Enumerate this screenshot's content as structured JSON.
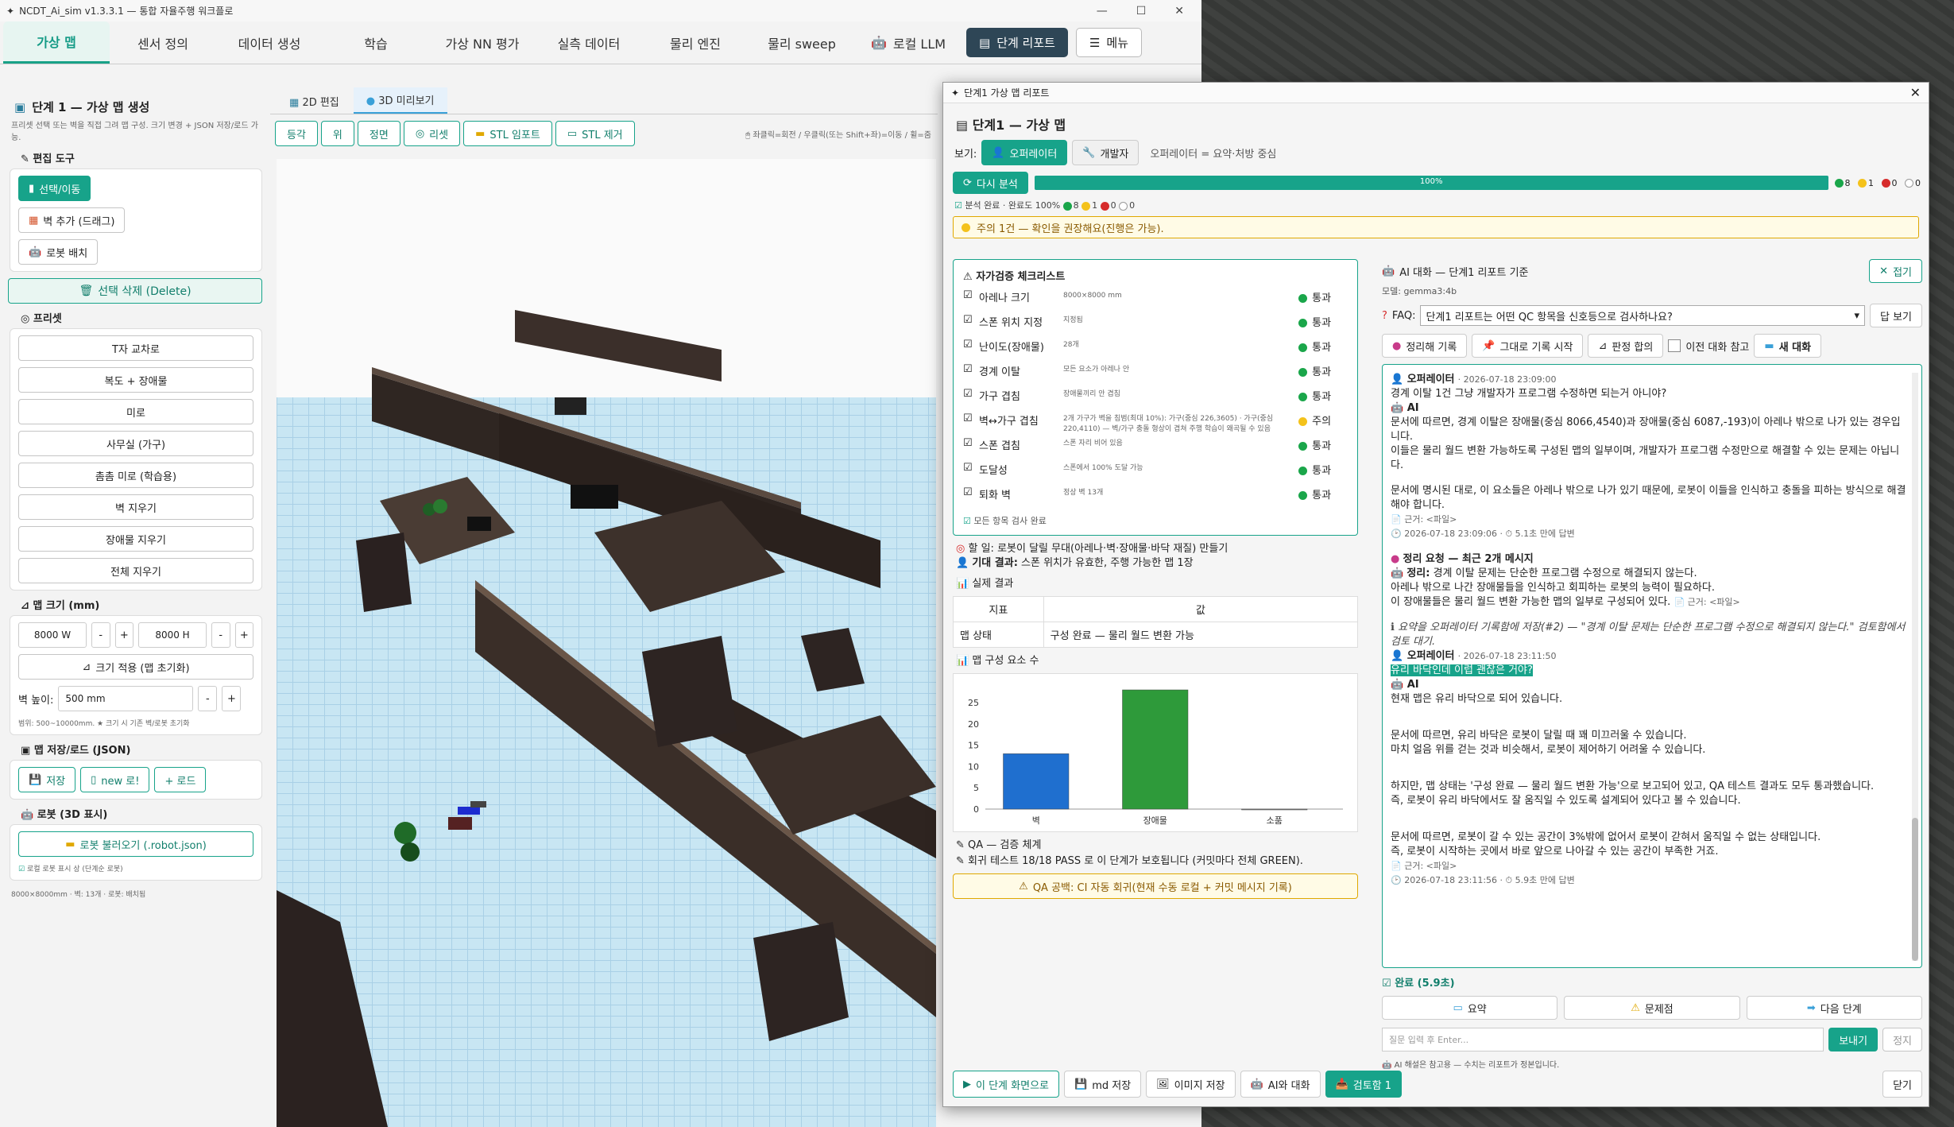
{
  "titlebar": {
    "title": "NCDT_Ai_sim v1.3.3.1 — 통합 자율주행 워크플로",
    "min": "—",
    "max": "☐",
    "close": "✕"
  },
  "tabs": [
    {
      "label": "가상 맵",
      "icon": "map-icon"
    },
    {
      "label": "센서 정의"
    },
    {
      "label": "데이터 생성"
    },
    {
      "label": "학습"
    },
    {
      "label": "가상 NN 평가"
    },
    {
      "label": "실측 데이터"
    },
    {
      "label": "물리 엔진"
    },
    {
      "label": "물리 sweep"
    },
    {
      "label": "로컬 LLM",
      "icon": "robot-icon"
    }
  ],
  "report_button": "단계 리포트",
  "menu_button": "메뉴",
  "left": {
    "title": "단계 1 — 가상 맵 생성",
    "hint": "프리셋 선택 또는 벽을 직접 그려 맵 구성. 크기 변경 + JSON 저장/로드 가능.",
    "edit_tools": "편집 도구",
    "tool_select": "선택/이동",
    "tool_wall": "벽 추가 (드래그)",
    "tool_robot": "로봇 배치",
    "delete": "선택 삭제 (Delete)",
    "preset": "프리셋",
    "presets": [
      "T자 교차로",
      "복도 + 장애물",
      "미로",
      "사무실 (가구)",
      "촘촘 미로 (학습용)",
      "벽 지우기",
      "장애물 지우기",
      "전체 지우기"
    ],
    "mapsize": "맵 크기 (mm)",
    "width_val": "8000 W",
    "height_val": "8000 H",
    "apply_size": "크기 적용 (맵 초기화)",
    "wall_height_label": "벽 높이:",
    "wall_height_val": "500 mm",
    "range_hint": "범위: 500~10000mm. ★ 크기 시 기존 벽/로봇 초기화",
    "saveload": "맵 저장/로드 (JSON)",
    "save": "저장",
    "new_save": "new 로!",
    "load": "+ 로드",
    "robot": "로봇 (3D 표시)",
    "load_robot": "로봇 불러오기 (.robot.json)",
    "robot_opt": "로컬 로봇 표시 상 (단계순 로봇)",
    "status": "8000×8000mm · 벽: 13개 · 로봇: 배치됨"
  },
  "center": {
    "tab_2d": "2D 편집",
    "tab_3d": "3D 미리보기",
    "tools": [
      "등각",
      "위",
      "정면",
      "리셋",
      "STL 임포트",
      "STL 제거"
    ],
    "tip": "🖱 좌클릭=회전 / 우클릭(또는 Shift+좌)=이동 / 휠=줌"
  },
  "report": {
    "window_title": "단계1 가상 맵 리포트",
    "heading": "단계1 — 가상 맵",
    "view_label": "보기:",
    "view_operator": "오퍼레이터",
    "view_dev": "개발자",
    "view_desc": "오퍼레이터 = 요약·처방 중심",
    "reanalyze": "다시 분석",
    "progress": "100%",
    "progress_value": 100,
    "counts": {
      "green": "8",
      "yellow": "1",
      "red": "0",
      "empty": "0"
    },
    "analysis": "분석 완료 · 완료도 100%",
    "caution": "주의 1건 — 확인을 권장해요(진행은 가능).",
    "checklist_title": "자가검증 체크리스트",
    "checklist": [
      {
        "name": "아레나 크기",
        "detail": "8000×8000 mm",
        "status": "통과",
        "color": "green"
      },
      {
        "name": "스폰 위치 지정",
        "detail": "지정됨",
        "status": "통과",
        "color": "green"
      },
      {
        "name": "난이도(장애물)",
        "detail": "28개",
        "status": "통과",
        "color": "green"
      },
      {
        "name": "경계 이탈",
        "detail": "모든 요소가 아레나 안",
        "status": "통과",
        "color": "green"
      },
      {
        "name": "가구 겹침",
        "detail": "장애물끼리 안 겹침",
        "status": "통과",
        "color": "green"
      },
      {
        "name": "벽↔가구 겹침",
        "detail": "2개 가구가 벽을 침범(최대 10%): 가구(중심 226,3605) · 가구(중심 220,4110) — 벽/가구 충돌 형상이 겹쳐 주행 학습이 왜곡될 수 있음",
        "status": "주의",
        "color": "yellow"
      },
      {
        "name": "스폰 겹침",
        "detail": "스폰 자리 비어 있음",
        "status": "통과",
        "color": "green"
      },
      {
        "name": "도달성",
        "detail": "스폰에서 100% 도달 가능",
        "status": "통과",
        "color": "green"
      },
      {
        "name": "퇴화 벽",
        "detail": "정상 벽 13개",
        "status": "통과",
        "color": "green"
      }
    ],
    "all_checked": "모든 항목 검사 완료",
    "todo_label": "할 일:",
    "todo": "로봇이 달릴 무대(아레나·벽·장애물·바닥 재질) 만들기",
    "expect_label": "기대 결과:",
    "expect": "스폰 위치가 유효한, 주행 가능한 맵 1장",
    "results_title": "실제 결과",
    "table_head": [
      "지표",
      "값"
    ],
    "table_rows": [
      [
        "맵 상태",
        "구성 완료 — 물리 월드 변환 가능"
      ]
    ],
    "chart_title": "맵 구성 요소 수",
    "qa_title": "QA — 검증 체계",
    "qa_line": "회귀 테스트 18/18 PASS 로 이 단계가 보호됩니다 (커밋마다 전체 GREEN).",
    "qa_warn": "QA 공백: CI 자동 회귀(현재 수동 로컬 + 커밋 메시지 기록)"
  },
  "chart_data": {
    "type": "bar",
    "categories": [
      "벽",
      "장애물",
      "소품"
    ],
    "values": [
      13,
      28,
      0
    ],
    "colors": [
      "#1f6fcf",
      "#2e9a3a",
      "#888888"
    ],
    "ylim": [
      0,
      28
    ],
    "yticks": [
      0,
      5,
      10,
      15,
      20,
      25
    ],
    "title": "맵 구성 요소 수"
  },
  "ai": {
    "title": "AI 대화 — 단계1 리포트 기준",
    "close": "접기",
    "model": "모델: gemma3:4b",
    "faq_label": "FAQ:",
    "faq_value": "단계1 리포트는 어떤 QC 항목을 신호등으로 검사하나요?",
    "faq_view": "답 보기",
    "buttons": [
      "정리해 기록",
      "그대로 기록 시작",
      "판정 합의"
    ],
    "prev_ctx": "이전 대화 참고",
    "new_chat": "새 대화",
    "messages": {
      "op1": "오퍼레이터",
      "op1_time": "· 2026-07-18 23:09:00",
      "q1": "경계 이탈 1건 그냥 개발자가 프로그램 수정하면 되는거 아니야?",
      "ai": "AI",
      "a1_1": "문서에 따르면, 경계 이탈은 장애물(중심 8066,4540)과 장애물(중심 6087,-193)이 아레나 밖으로 나가 있는 경우입니다.",
      "a1_2": "이들은 물리 월드 변환 가능하도록 구성된 맵의 일부이며, 개발자가 프로그램 수정만으로 해결할 수 있는 문제는 아닙니다.",
      "a1_3": "문서에 명시된 대로, 이 요소들은 아레나 밖으로 나가 있기 때문에, 로봇이 이들을 인식하고 충돌을 피하는 방식으로 해결해야 합니다.",
      "src1": "근거: <파일>",
      "meta1": "2026-07-18 23:09:06 · ⏱ 5.1초 만에 답변",
      "sum_title": "정리 요청 — 최근 2개 메시지",
      "sum_label": "정리:",
      "sum1": "경계 이탈 문제는 단순한 프로그램 수정으로 해결되지 않는다.",
      "sum2": "아레나 밖으로 나간 장애물들을 인식하고 회피하는 로봇의 능력이 필요하다.",
      "sum3": "이 장애물들은 물리 월드 변환 가능한 맵의 일부로 구성되어 있다.",
      "src2": "근거: <파일>",
      "saved": "요약을 오퍼레이터 기록함에 저장(#2) — \"경계 이탈 문제는 단순한 프로그램 수정으로 해결되지 않는다.\" 검토함에서 검토 대기.",
      "op2": "오퍼레이터",
      "op2_time": "· 2026-07-18 23:11:50",
      "q2": "유리 바닥인데 이럽 괜찮은 거야?",
      "a2_1": "현재 맵은 유리 바닥으로 되어 있습니다.",
      "a2_2": "문서에 따르면, 유리 바닥은 로봇이 달릴 때 꽤 미끄러울 수 있습니다.",
      "a2_3": "마치 얼음 위를 걷는 것과 비슷해서, 로봇이 제어하기 어려울 수 있습니다.",
      "a2_4": "하지만, 맵 상태는 '구성 완료 — 물리 월드 변환 가능'으로 보고되어 있고, QA 테스트 결과도 모두 통과했습니다.",
      "a2_5": "즉, 로봇이 유리 바닥에서도 잘 움직일 수 있도록 설계되어 있다고 볼 수 있습니다.",
      "a2_6": "문서에 따르면, 로봇이 갈 수 있는 공간이 3%밖에 없어서 로봇이 갇혀서 움직일 수 없는 상태입니다.",
      "a2_7": "즉, 로봇이 시작하는 곳에서 바로 앞으로 나아갈 수 있는 공간이 부족한 거죠.",
      "src3": "근거: <파일>",
      "meta2": "2026-07-18 23:11:56 · ⏱ 5.9초 만에 답변"
    },
    "done": "완료 (5.9초)",
    "actions": [
      "요약",
      "문제점",
      "다음 단계"
    ],
    "placeholder": "질문 입력 후 Enter...",
    "send": "보내기",
    "stop": "정지",
    "footnote": "AI 해설은 참고용 — 수치는 리포트가 정본입니다."
  },
  "bottom": {
    "focus": "이 단계 화면으로",
    "md": "md 저장",
    "img": "이미지 저장",
    "ai": "AI와 대화",
    "review": "검토함 1",
    "close": "닫기"
  }
}
